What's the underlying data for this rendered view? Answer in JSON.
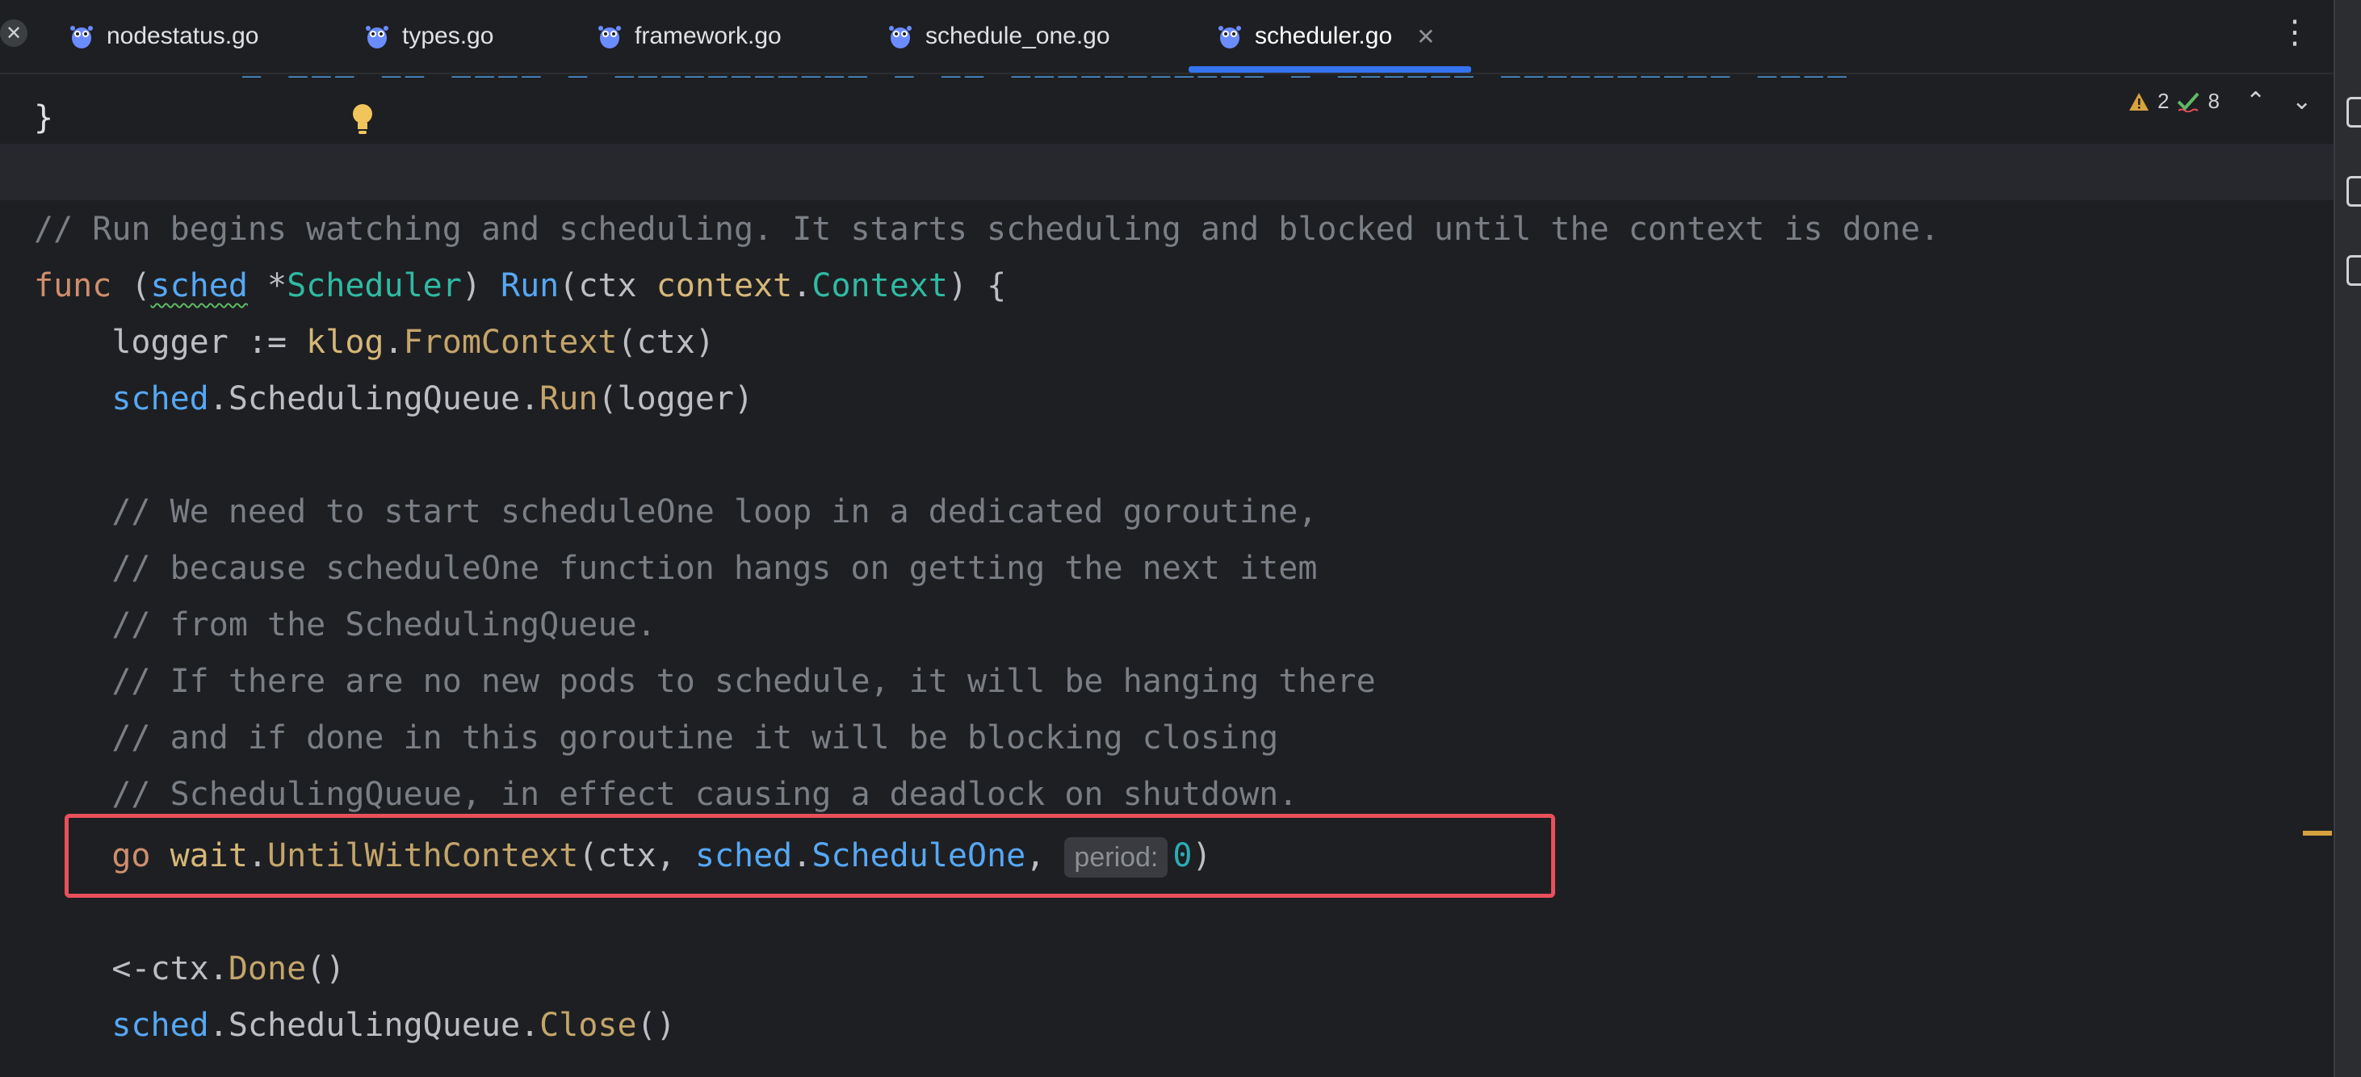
{
  "tabs": [
    {
      "label": "nodestatus.go"
    },
    {
      "label": "types.go"
    },
    {
      "label": "framework.go"
    },
    {
      "label": "schedule_one.go"
    },
    {
      "label": "scheduler.go",
      "active": true
    }
  ],
  "tab_close_glyph": "✕",
  "more_glyph": "⋮",
  "inspections": {
    "warnings": "2",
    "checks": "8"
  },
  "code": {
    "closing_brace": "}",
    "doc_comment": "// Run begins watching and scheduling. It starts scheduling and blocked until the context is done.",
    "func_kw": "func",
    "open_paren": " (",
    "recv": "sched",
    "star": " *",
    "recv_type": "Scheduler",
    "close_paren": ") ",
    "func_name": "Run",
    "params_open": "(ctx ",
    "param_pkg": "context",
    "dot": ".",
    "param_type": "Context",
    "params_close": ") {",
    "l1_indent_var": "    logger := ",
    "l1_pkg": "klog",
    "l1_call": "FromContext",
    "l1_args": "(ctx)",
    "l2_recv": "sched",
    "l2_field": ".SchedulingQueue.",
    "l2_call": "Run",
    "l2_args": "(logger)",
    "comments": [
      "// We need to start scheduleOne loop in a dedicated goroutine,",
      "// because scheduleOne function hangs on getting the next item",
      "// from the SchedulingQueue.",
      "// If there are no new pods to schedule, it will be hanging there",
      "// and if done in this goroutine it will be blocking closing",
      "// SchedulingQueue, in effect causing a deadlock on shutdown."
    ],
    "go_kw": "go",
    "go_pkg": "wait",
    "go_call": "UntilWithContext",
    "go_args_open": "(ctx, ",
    "go_recv": "sched",
    "go_method": "ScheduleOne",
    "go_comma": ", ",
    "hint_label": "period:",
    "go_num": "0",
    "go_close": ")",
    "done_pre": "<-ctx.",
    "done_call": "Done",
    "done_args": "()",
    "close_recv": "sched",
    "close_field": ".SchedulingQueue.",
    "close_call": "Close",
    "close_args": "()"
  },
  "colors": {
    "background": "#1e1f22",
    "comment": "#7a7e85",
    "keyword": "#cf8e6d",
    "function": "#56a8f5",
    "highlight_border": "#e8505b",
    "active_tab_underline": "#3574f0"
  }
}
